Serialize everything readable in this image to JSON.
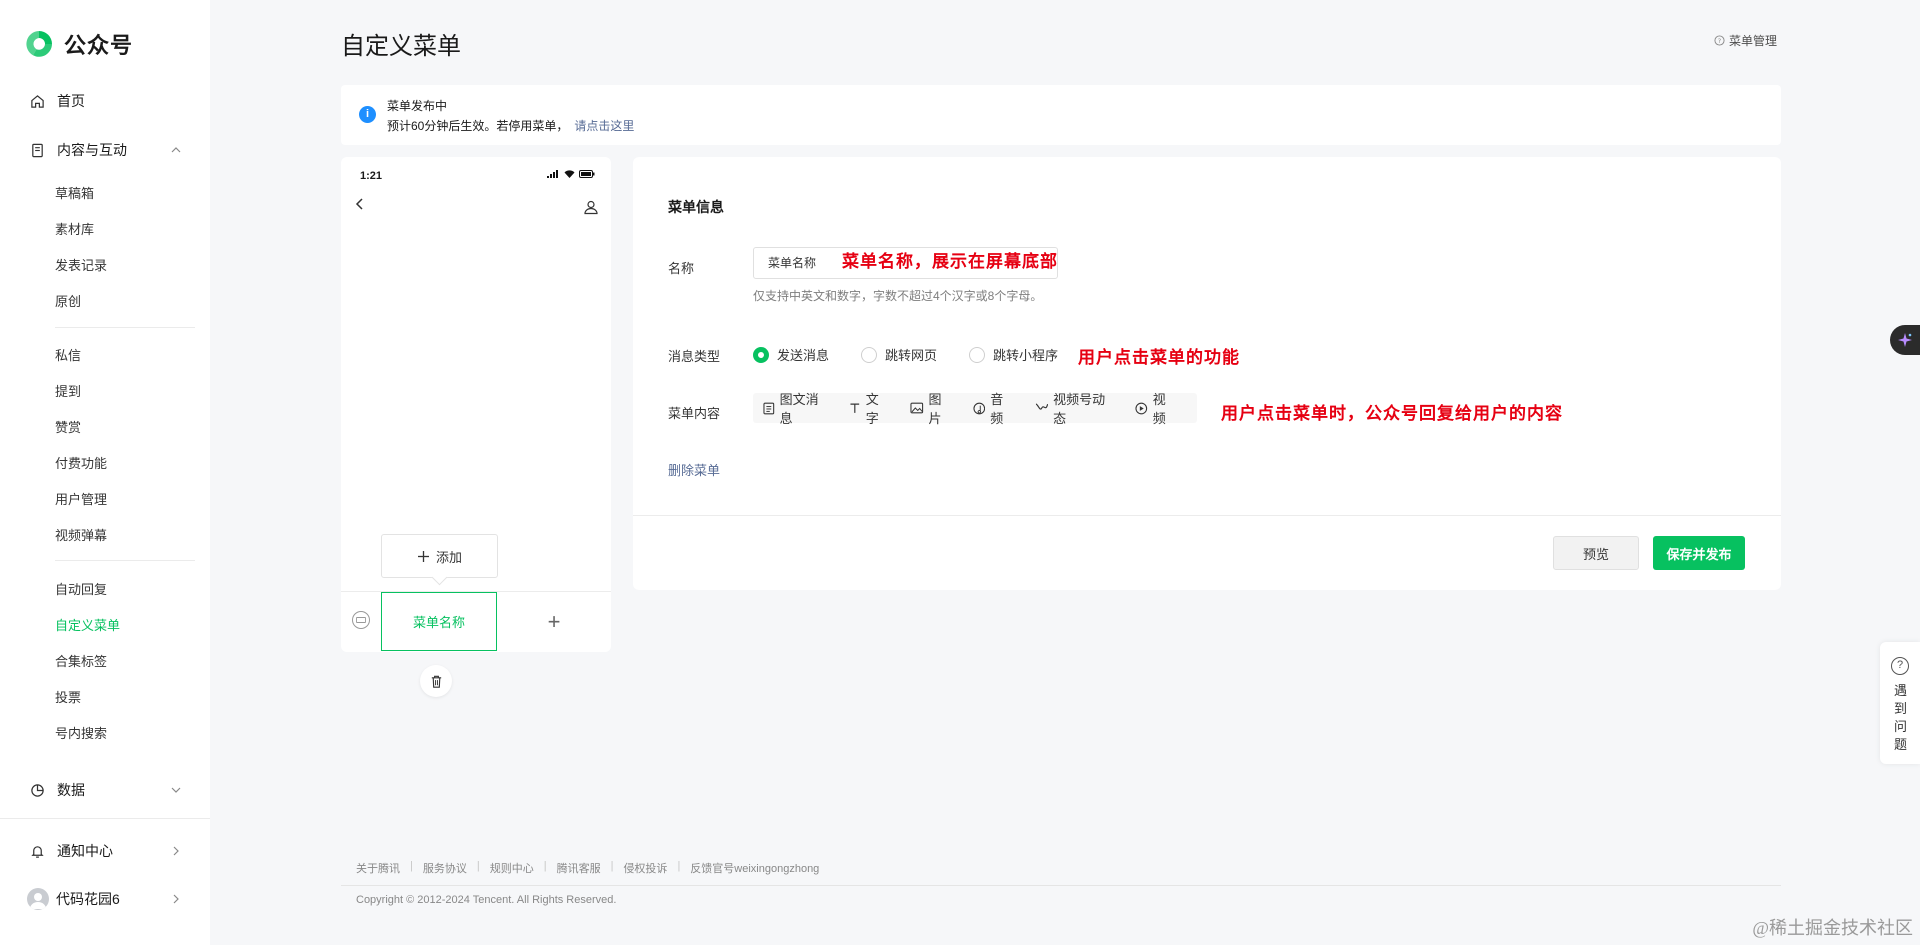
{
  "brand": {
    "name": "公众号",
    "color": "#07c160"
  },
  "sidebar": {
    "home": "首页",
    "content_group": "内容与互动",
    "content_items_a": [
      "草稿箱",
      "素材库",
      "发表记录",
      "原创"
    ],
    "content_items_b": [
      "私信",
      "提到",
      "赞赏",
      "付费功能",
      "用户管理",
      "视频弹幕"
    ],
    "content_items_c": [
      "自动回复",
      "自定义菜单",
      "合集标签",
      "投票",
      "号内搜索"
    ],
    "data_group": "数据",
    "notification": "通知中心",
    "account": "代码花园6"
  },
  "header": {
    "title": "自定义菜单",
    "menu_manage": "菜单管理"
  },
  "notice": {
    "title": "菜单发布中",
    "desc": "预计60分钟后生效。若停用菜单，",
    "link": "请点击这里"
  },
  "phone": {
    "time": "1:21",
    "add_label": "添加",
    "menu_tab": "菜单名称",
    "plus": "+"
  },
  "panel": {
    "title": "菜单信息",
    "name_label": "名称",
    "name_value": "菜单名称",
    "name_hint": "仅支持中英文和数字，字数不超过4个汉字或8个字母。",
    "type_label": "消息类型",
    "types": [
      "发送消息",
      "跳转网页",
      "跳转小程序"
    ],
    "selected_type": "发送消息",
    "content_label": "菜单内容",
    "content_types": [
      "图文消息",
      "文字",
      "图片",
      "音频",
      "视频号动态",
      "视频"
    ],
    "delete": "删除菜单",
    "preview": "预览",
    "publish": "保存并发布"
  },
  "annotations": {
    "name": "菜单名称，展示在屏幕底部",
    "type": "用户点击菜单的功能",
    "content": "用户点击菜单时，公众号回复给用户的内容"
  },
  "footer": {
    "links": [
      "关于腾讯",
      "服务协议",
      "规则中心",
      "腾讯客服",
      "侵权投诉",
      "反馈官号weixingongzhong"
    ],
    "copyright": "Copyright © 2012-2024 Tencent. All Rights Reserved."
  },
  "help": {
    "text": "遇到问题"
  },
  "watermark": "@稀土掘金技术社区"
}
